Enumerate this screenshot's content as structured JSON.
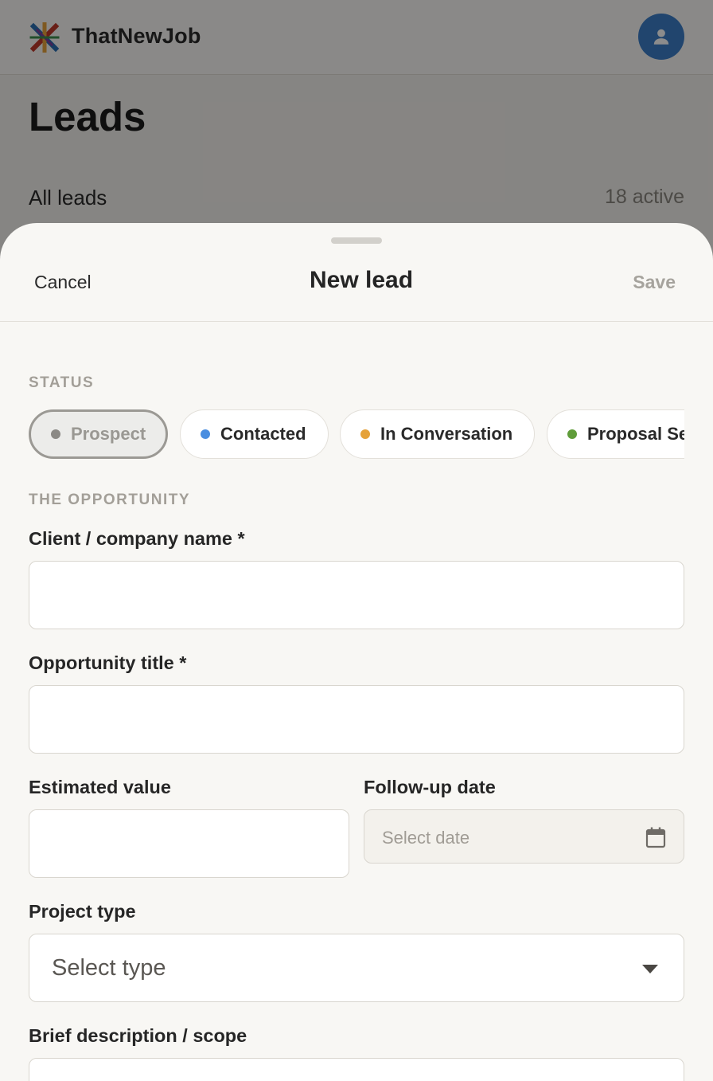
{
  "app": {
    "brand": "ThatNewJob",
    "page_title": "Leads",
    "list_title": "All leads",
    "list_count": "18 active"
  },
  "sheet": {
    "cancel_label": "Cancel",
    "title": "New lead",
    "save_label": "Save"
  },
  "status": {
    "section_label": "STATUS",
    "chips": [
      {
        "label": "Prospect",
        "color": "#8b8985",
        "selected": true
      },
      {
        "label": "Contacted",
        "color": "#4a8ee0",
        "selected": false
      },
      {
        "label": "In Conversation",
        "color": "#e5a23a",
        "selected": false
      },
      {
        "label": "Proposal Sent",
        "color": "#5f9c39",
        "selected": false
      }
    ]
  },
  "opportunity": {
    "section_label": "THE OPPORTUNITY",
    "client_label": "Client / company name *",
    "client_value": "",
    "title_label": "Opportunity title *",
    "title_value": "",
    "value_label": "Estimated value",
    "value_value": "",
    "followup_label": "Follow-up date",
    "followup_placeholder": "Select date",
    "project_type_label": "Project type",
    "project_type_placeholder": "Select type",
    "description_label": "Brief description / scope"
  }
}
